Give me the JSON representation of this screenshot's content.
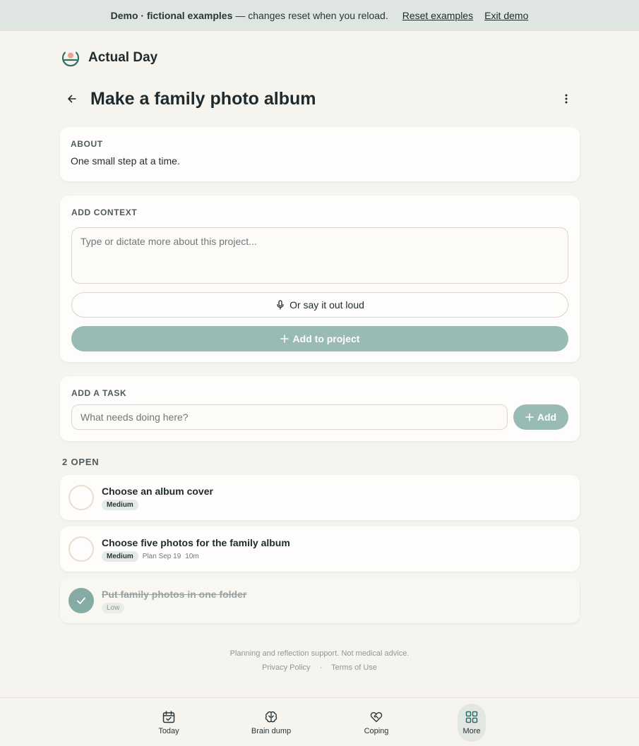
{
  "banner": {
    "bold": "Demo · fictional examples",
    "text": "— changes reset when you reload.",
    "reset_link": "Reset examples",
    "exit_link": "Exit demo"
  },
  "app": {
    "name": "Actual Day"
  },
  "page": {
    "title": "Make a family photo album"
  },
  "about": {
    "label": "ABOUT",
    "text": "One small step at a time."
  },
  "context": {
    "label": "ADD CONTEXT",
    "placeholder": "Type or dictate more about this project...",
    "say_label": "Or say it out loud",
    "add_label": "Add to project"
  },
  "add_task": {
    "label": "ADD A TASK",
    "placeholder": "What needs doing here?",
    "button_label": "Add"
  },
  "open_count": "2 OPEN",
  "tasks": [
    {
      "title": "Choose an album cover",
      "priority": "Medium",
      "plan": "",
      "duration": "",
      "done": false
    },
    {
      "title": "Choose five photos for the family album",
      "priority": "Medium",
      "plan": "Plan Sep 19",
      "duration": "10m",
      "done": false
    },
    {
      "title": "Put family photos in one folder",
      "priority": "Low",
      "plan": "",
      "duration": "",
      "done": true
    }
  ],
  "footer": {
    "disclaimer": "Planning and reflection support. Not medical advice.",
    "privacy": "Privacy Policy",
    "separator": "·",
    "terms": "Terms of Use"
  },
  "nav": {
    "today": "Today",
    "brain_dump": "Brain dump",
    "coping": "Coping",
    "more": "More"
  },
  "colors": {
    "accent": "#98bbb5",
    "accent_dark": "#2f6f66",
    "background": "#f6f4ee",
    "banner": "#dfe5e0"
  }
}
